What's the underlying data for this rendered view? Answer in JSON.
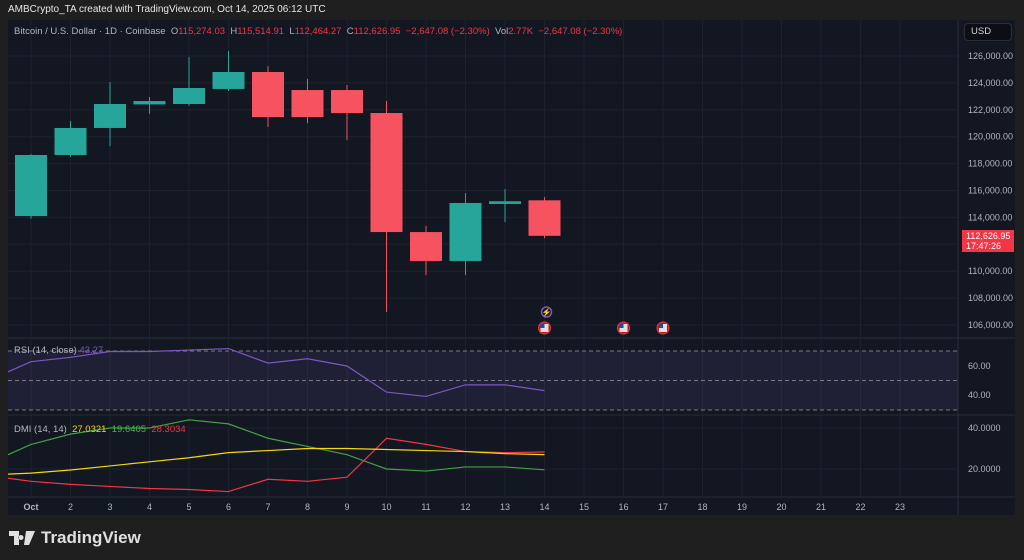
{
  "credit": "AMBCrypto_TA created with TradingView.com, Oct 14, 2025 06:12 UTC",
  "legend": {
    "symbol": "Bitcoin / U.S. Dollar · 1D · Coinbase",
    "open_label": "O",
    "open": "115,274.03",
    "high_label": "H",
    "high": "115,514.91",
    "low_label": "L",
    "low": "112,464.27",
    "close_label": "C",
    "close": "112,626.95",
    "change": "−2,647.08 (−2.30%)",
    "vol_label": "Vol",
    "vol": "2.77K",
    "vol_change": "−2,647.08 (−2.30%)"
  },
  "currency": "USD",
  "price_tag": {
    "price": "112,626.95",
    "countdown": "17:47:26"
  },
  "price_axis": [
    "126,000.00",
    "124,000.00",
    "122,000.00",
    "120,000.00",
    "118,000.00",
    "116,000.00",
    "114,000.00",
    "112,000.00",
    "110,000.00",
    "108,000.00",
    "106,000.00"
  ],
  "rsi": {
    "label": "RSI (14, close)",
    "value": "43.27",
    "axis": [
      "60.00",
      "40.00"
    ],
    "values": [
      63,
      66,
      70,
      70,
      71,
      72,
      62,
      65,
      60,
      42,
      39,
      47,
      47,
      43
    ]
  },
  "dmi": {
    "label": "DMI (14, 14)",
    "adx": "27.0321",
    "plus_di": "19.6405",
    "minus_di": "28.3034",
    "axis": [
      "40.0000",
      "20.0000"
    ],
    "adx_values": [
      18,
      19.5,
      21.5,
      23.5,
      25.5,
      28,
      29,
      30,
      30,
      29.5,
      29,
      28.5,
      27.5,
      27
    ],
    "plus_values": [
      32,
      37,
      40,
      40,
      44,
      42,
      35,
      31,
      27,
      20,
      19,
      21,
      21,
      19.6
    ],
    "minus_values": [
      14,
      12.5,
      11.5,
      10.5,
      10,
      9,
      15,
      14,
      16,
      35,
      32,
      28.5,
      28,
      28.3
    ]
  },
  "time_axis": [
    "Oct",
    "2",
    "3",
    "4",
    "5",
    "6",
    "7",
    "8",
    "9",
    "10",
    "11",
    "12",
    "13",
    "14",
    "15",
    "16",
    "17",
    "18",
    "19",
    "20",
    "21",
    "22",
    "23"
  ],
  "candles": [
    [
      114100,
      118700,
      113900,
      118640
    ],
    [
      118640,
      121170,
      118500,
      120650
    ],
    [
      120650,
      124070,
      119300,
      122430
    ],
    [
      122400,
      122950,
      121700,
      122650
    ],
    [
      122430,
      125930,
      122300,
      123620
    ],
    [
      123550,
      126370,
      123400,
      124810
    ],
    [
      124810,
      125250,
      120720,
      121460
    ],
    [
      123470,
      124290,
      121000,
      121460
    ],
    [
      123470,
      123840,
      119750,
      121760
    ],
    [
      121760,
      122650,
      106970,
      112910
    ],
    [
      112910,
      113360,
      109720,
      110760
    ],
    [
      110760,
      115810,
      109720,
      115070
    ],
    [
      115000,
      116100,
      113660,
      115200
    ],
    [
      115270,
      115510,
      112460,
      112630
    ]
  ],
  "events": [
    {
      "day": 14,
      "icon": "earnings-lightning-icon"
    },
    {
      "day": 14,
      "icon": "us-flag-icon"
    },
    {
      "day": 16,
      "icon": "us-flag-icon"
    },
    {
      "day": 17,
      "icon": "us-flag-icon"
    }
  ],
  "colors": {
    "up": "#26a69a",
    "down": "#f7525f",
    "rsi": "#7e57c2",
    "adx": "#f5d90a",
    "plus": "#43a047",
    "minus": "#f23645"
  },
  "brand": "TradingView"
}
